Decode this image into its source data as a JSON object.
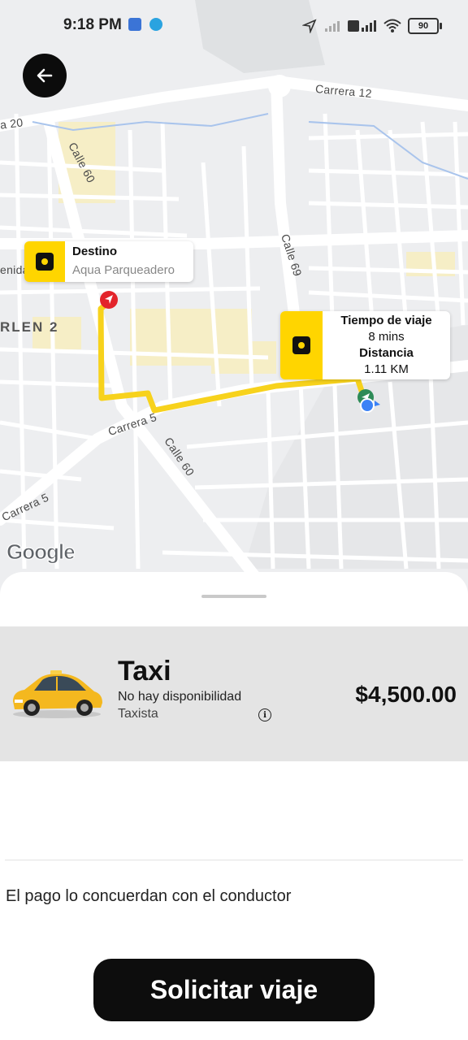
{
  "status_bar": {
    "time": "9:18 PM",
    "battery": "90"
  },
  "map": {
    "streets": {
      "carrera_12": "Carrera 12",
      "carrera_20": "a 20",
      "calle_60_top": "Calle 60",
      "calle_69": "Calle 69",
      "avenida": "enida",
      "carrera_5_mid": "Carrera 5",
      "calle_60_bottom": "Calle 60",
      "carrera_5_left": "Carrera 5",
      "district": "RLEN 2"
    },
    "destination": {
      "title": "Destino",
      "address": "Aqua Parqueadero"
    },
    "trip": {
      "time_label": "Tiempo de viaje",
      "time_value": "8 mins",
      "distance_label": "Distancia",
      "distance_value": "1.11 KM"
    },
    "google_logo": "Google",
    "colors": {
      "route": "#f7d21c",
      "accent": "#ffd500"
    }
  },
  "ride_option": {
    "name": "Taxi",
    "status": "No hay disponibilidad",
    "driver_type": "Taxista",
    "price": "$4,500.00"
  },
  "payment_note": "El pago lo concuerdan con el conductor",
  "cta": {
    "label": "Solicitar viaje"
  },
  "icons": [
    "back-arrow-icon",
    "stop-square-icon",
    "destination-pin-icon",
    "origin-location-icon",
    "info-icon",
    "taxi-car-image"
  ]
}
